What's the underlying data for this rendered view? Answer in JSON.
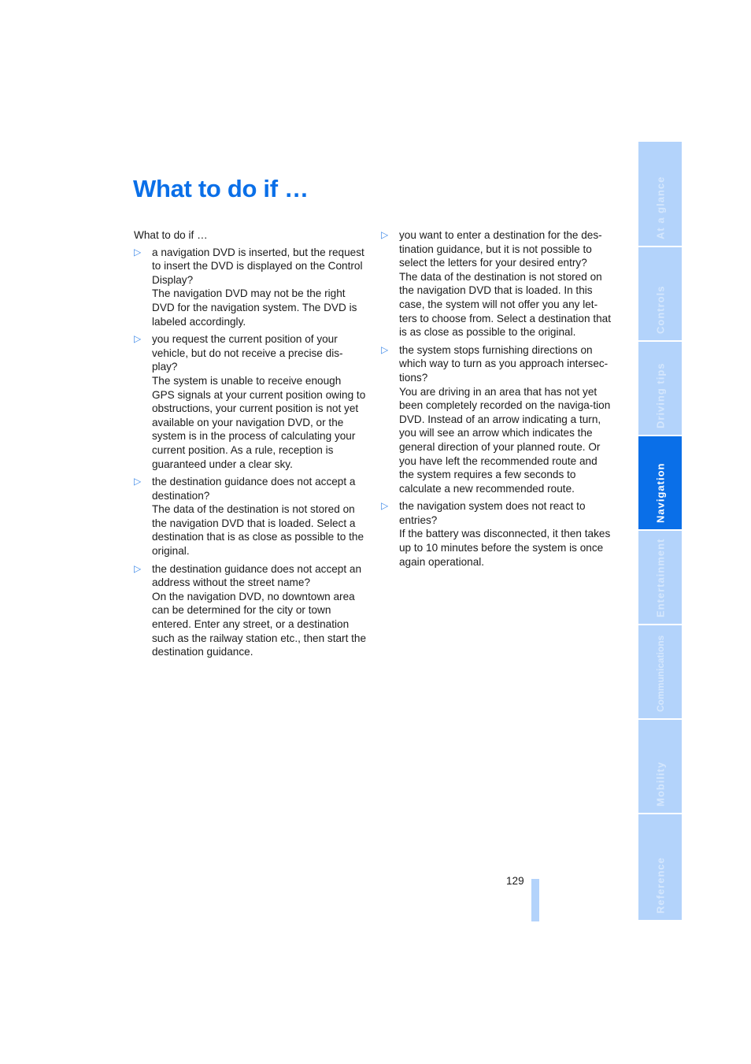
{
  "page": {
    "title": "What to do if …",
    "page_number": "129"
  },
  "left_column": {
    "intro": "What to do if …",
    "items": [
      {
        "question": "a navigation DVD is inserted, but the request to insert the DVD is displayed on the Control Display?",
        "answer": "The navigation DVD may not be the right DVD for the navigation system. The DVD is labeled accordingly."
      },
      {
        "question": "you request the current position of your vehicle, but do not receive a precise dis-play?",
        "answer": "The system is unable to receive enough GPS signals at your current position owing to obstructions, your current position is not yet available on your navigation DVD, or the system is in the process of calculating your current position. As a rule, reception is guaranteed under a clear sky."
      },
      {
        "question": "the destination guidance does not accept a destination?",
        "answer": "The data of the destination is not stored on the navigation DVD that is loaded. Select a destination that is as close as possible to the original."
      },
      {
        "question": "the destination guidance does not accept an address without the street name?",
        "answer": "On the navigation DVD, no downtown area can be determined for the city or town entered. Enter any street, or a destination such as the railway station etc., then start the destination guidance."
      }
    ]
  },
  "right_column": {
    "items": [
      {
        "question": "you want to enter a destination for the des-tination guidance, but it is not possible to select the letters for your desired entry?",
        "answer": "The data of the destination is not stored on the navigation DVD that is loaded. In this case, the system will not offer you any let-ters to choose from. Select a destination that is as close as possible to the original."
      },
      {
        "question": "the system stops furnishing directions on which way to turn as you approach intersec-tions?",
        "answer": "You are driving in an area that has not yet been completely recorded on the naviga-tion DVD. Instead of an arrow indicating a turn, you will see an arrow which indicates the general direction of your planned route. Or you have left the recommended route and the system requires a few seconds to calculate a new recommended route."
      },
      {
        "question": "the navigation system does not react to entries?",
        "answer": "If the battery was disconnected, it then takes up to 10 minutes before the system is once again operational."
      }
    ]
  },
  "sidebar": {
    "active": "Navigation",
    "tabs": [
      {
        "label": "At a glance"
      },
      {
        "label": "Controls"
      },
      {
        "label": "Driving tips"
      },
      {
        "label": "Navigation"
      },
      {
        "label": "Entertainment"
      },
      {
        "label": "Communications"
      },
      {
        "label": "Mobility"
      },
      {
        "label": "Reference"
      }
    ]
  },
  "colors": {
    "accent": "#0a6fe8",
    "tab_inactive": "#b3d3fb"
  },
  "icons": {
    "bullet": "triangle-right-outline-icon"
  }
}
